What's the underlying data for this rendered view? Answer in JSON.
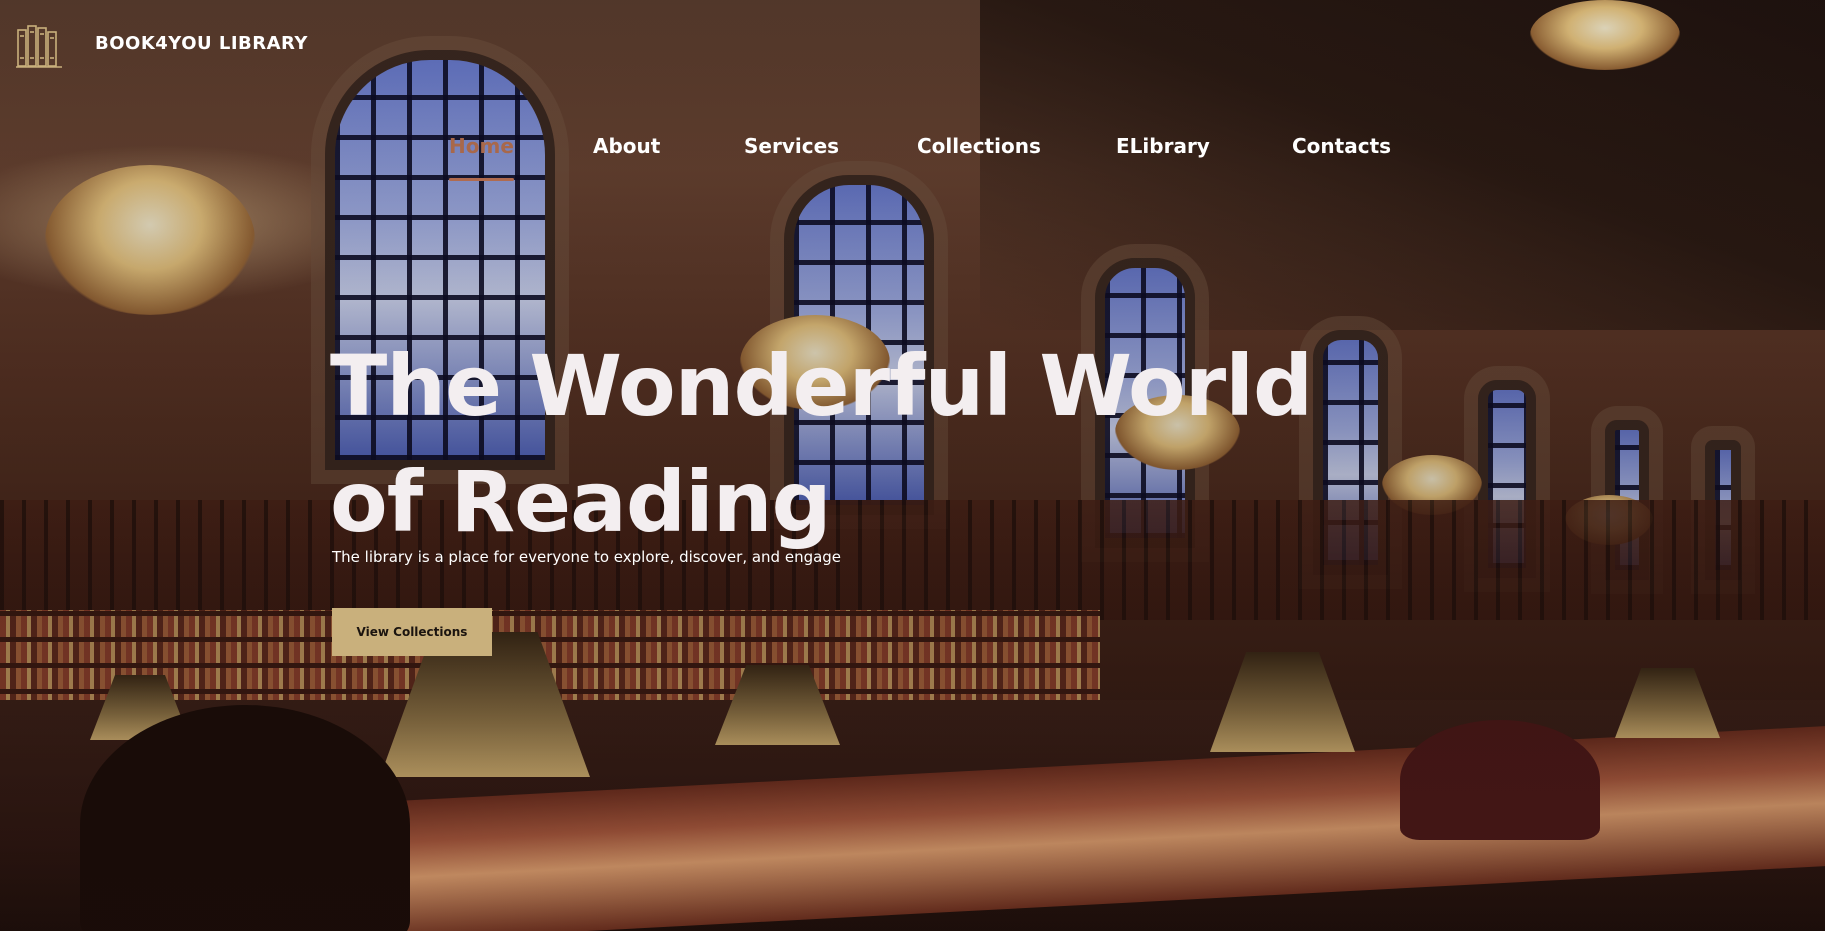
{
  "header": {
    "brand": "BOOK4YOU LIBRARY",
    "logo_icon": "library-books-icon"
  },
  "nav": {
    "items": [
      {
        "label": "Home",
        "active": true
      },
      {
        "label": "About",
        "active": false
      },
      {
        "label": "Services",
        "active": false
      },
      {
        "label": "Collections",
        "active": false
      },
      {
        "label": "ELibrary",
        "active": false
      },
      {
        "label": "Contacts",
        "active": false
      }
    ]
  },
  "hero": {
    "title_line1": "The Wonderful World",
    "title_line2": "of Reading",
    "subtitle": "The library is a place for everyone to explore, discover, and engage",
    "cta_label": "View Collections"
  },
  "colors": {
    "accent": "#c9b07c",
    "active_nav": "#a8684b",
    "text": "#ffffff"
  }
}
